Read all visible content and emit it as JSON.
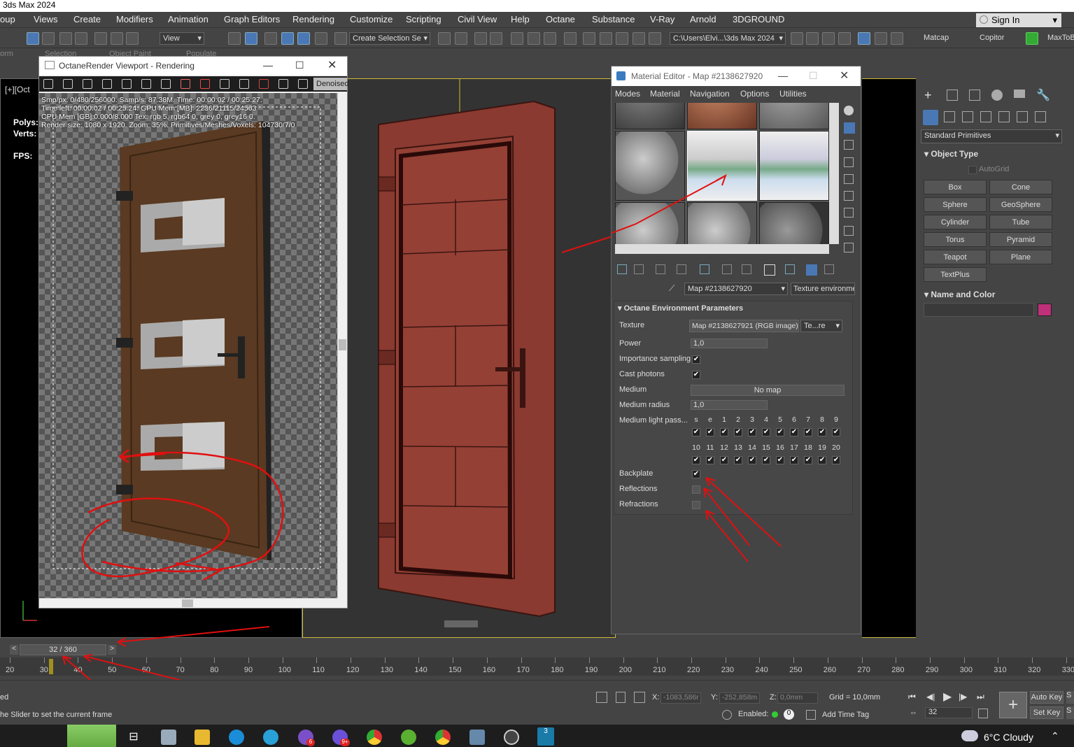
{
  "window_title": "3ds Max 2024",
  "menus": [
    "oup",
    "Views",
    "Create",
    "Modifiers",
    "Animation",
    "Graph Editors",
    "Rendering",
    "Customize",
    "Scripting",
    "Civil View",
    "Help",
    "Octane",
    "Substance",
    "V-Ray",
    "Arnold",
    "3DGROUND"
  ],
  "sign_in": "Sign In",
  "toolbar": {
    "view_dd": "View",
    "selection_set": "Create Selection Se",
    "path": "C:\\Users\\Elvi...\\3ds Max 2024",
    "matcap": "Matcap",
    "copitor": "Copitor",
    "maxtob": "MaxToB"
  },
  "subbar": {
    "form": "orm",
    "selection": "Selection",
    "object_paint": "Object Paint",
    "populate": "Populate"
  },
  "viewport": {
    "label": "[+][Oct",
    "polys": "Polys:",
    "verts": "Verts:",
    "fps": "FPS:"
  },
  "octane": {
    "title": "OctaneRender Viewport - Rendering",
    "denoised": "Denoised",
    "stats": [
      "Smp/px: 0/480/256000.   Samp/s: 87.38M.   Time: 00:00:02 / 00:25:27.",
      "Time left: 00:00:02 / 00:25:24.   GPU Mem [MB]: 2236/21115/24563",
      "CPU Mem [GB]:0.000/8.000   Tex: rgb 5, rgb64 0, grey 0, grey16 0.",
      "Render size: 1080 x 1920.   Zoom: 35%.   Primitives/Meshes/Voxels: 104730/7/0"
    ]
  },
  "material_editor": {
    "title": "Material Editor - Map #2138627920",
    "menu": [
      "Modes",
      "Material",
      "Navigation",
      "Options",
      "Utilities"
    ],
    "map_name": "Map #2138627920",
    "map_type": "Texture environme",
    "rollout": "Octane Environment Parameters",
    "texture_label": "Texture",
    "texture_value": "Map #2138627921 (RGB image)",
    "texture_dd": "Te...re",
    "power_label": "Power",
    "power_value": "1,0",
    "importance_label": "Importance sampling",
    "cast_label": "Cast photons",
    "medium_label": "Medium",
    "medium_value": "No map",
    "medium_radius_label": "Medium radius",
    "medium_radius_value": "1,0",
    "light_pass_label": "Medium light pass...",
    "pass_row1": [
      "s",
      "e",
      "1",
      "2",
      "3",
      "4",
      "5",
      "6",
      "7",
      "8",
      "9"
    ],
    "pass_row2": [
      "10",
      "11",
      "12",
      "13",
      "14",
      "15",
      "16",
      "17",
      "18",
      "19",
      "20"
    ],
    "backplate_label": "Backplate",
    "reflections_label": "Reflections",
    "refractions_label": "Refractions"
  },
  "command_panel": {
    "dropdown": "Standard Primitives",
    "object_type": "Object Type",
    "autogrid": "AutoGrid",
    "buttons": [
      "Box",
      "Cone",
      "Sphere",
      "GeoSphere",
      "Cylinder",
      "Tube",
      "Torus",
      "Pyramid",
      "Teapot",
      "Plane",
      "TextPlus"
    ],
    "name_color": "Name and Color",
    "swatch_color": "#c0307a"
  },
  "timeline": {
    "frame": "32 / 360",
    "ticks": [
      "20",
      "30",
      "40",
      "50",
      "60",
      "70",
      "80",
      "90",
      "100",
      "110",
      "120",
      "130",
      "140",
      "150",
      "160",
      "170",
      "180",
      "190",
      "200",
      "210",
      "220",
      "230",
      "240",
      "250",
      "260",
      "270",
      "280",
      "290",
      "300",
      "310",
      "320",
      "330"
    ]
  },
  "status": {
    "left1": "ed",
    "left2": "he Slider to set the current frame",
    "x_label": "X:",
    "x_val": "-1083,586r",
    "y_label": "Y:",
    "y_val": "-252,858m",
    "z_label": "Z:",
    "z_val": "0,0mm",
    "grid": "Grid = 10,0mm",
    "enabled": "Enabled:",
    "add_time_tag": "Add Time Tag",
    "auto_key": "Auto Key",
    "set_key": "Set Key",
    "frame_spin": "32",
    "s1": "S",
    "s2": "S"
  },
  "taskbar": {
    "weather": "6°C  Cloudy",
    "badge1": "6",
    "badge2": "9+"
  }
}
